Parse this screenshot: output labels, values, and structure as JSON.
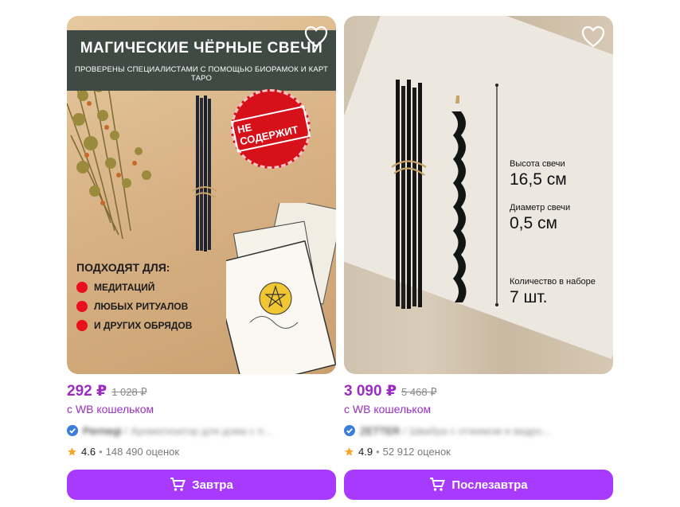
{
  "colors": {
    "accent": "#a73afd",
    "price": "#9b2ec1",
    "badge_red": "#d6111a"
  },
  "products": [
    {
      "image": {
        "banner_title": "МАГИЧЕСКИЕ ЧЁРНЫЕ СВЕЧИ",
        "banner_subtitle": "ПРОВЕРЕНЫ СПЕЦИАЛИСТАМИ С ПОМОЩЬЮ БИОРАМОК И КАРТ ТАРО",
        "stamp_text": "НЕ СОДЕРЖИТ",
        "stamp_ring_top": "АРОМАТИЧЕСКИЕ ПРИМЕСИ",
        "stamp_ring_bottom": "ИСКУССТВЕННЫЕ КРАСИТЕЛИ",
        "fits_heading": "ПОДХОДЯТ ДЛЯ:",
        "fits_items": [
          "МЕДИТАЦИЙ",
          "ЛЮБЫХ РИТУАЛОВ",
          "И ДРУГИХ ОБРЯДОВ"
        ],
        "tarot_caption": "ACE of"
      },
      "price": "292 ₽",
      "old_price": "1 028 ₽",
      "wallet": "с WB кошельком",
      "brand": "Permegi",
      "name": "Ароматизатор для дома с п...",
      "rating": "4.6",
      "reviews": "148 490 оценок",
      "button": "Завтра"
    },
    {
      "image": {
        "specs": [
          {
            "label": "Высота свечи",
            "value": "16,5 см"
          },
          {
            "label": "Диаметр свечи",
            "value": "0,5 см"
          },
          {
            "label": "Количество в наборе",
            "value": "7 шт."
          }
        ]
      },
      "price": "3 090 ₽",
      "old_price": "5 468 ₽",
      "wallet": "с WB кошельком",
      "brand": "ZETTER",
      "name": "Швабра с отжимом и ведро...",
      "rating": "4.9",
      "reviews": "52 912 оценок",
      "button": "Послезавтра"
    }
  ],
  "icons": {
    "favorite": "heart-outline-icon",
    "verified": "check-badge-icon",
    "rating": "star-icon",
    "cart": "cart-icon"
  }
}
